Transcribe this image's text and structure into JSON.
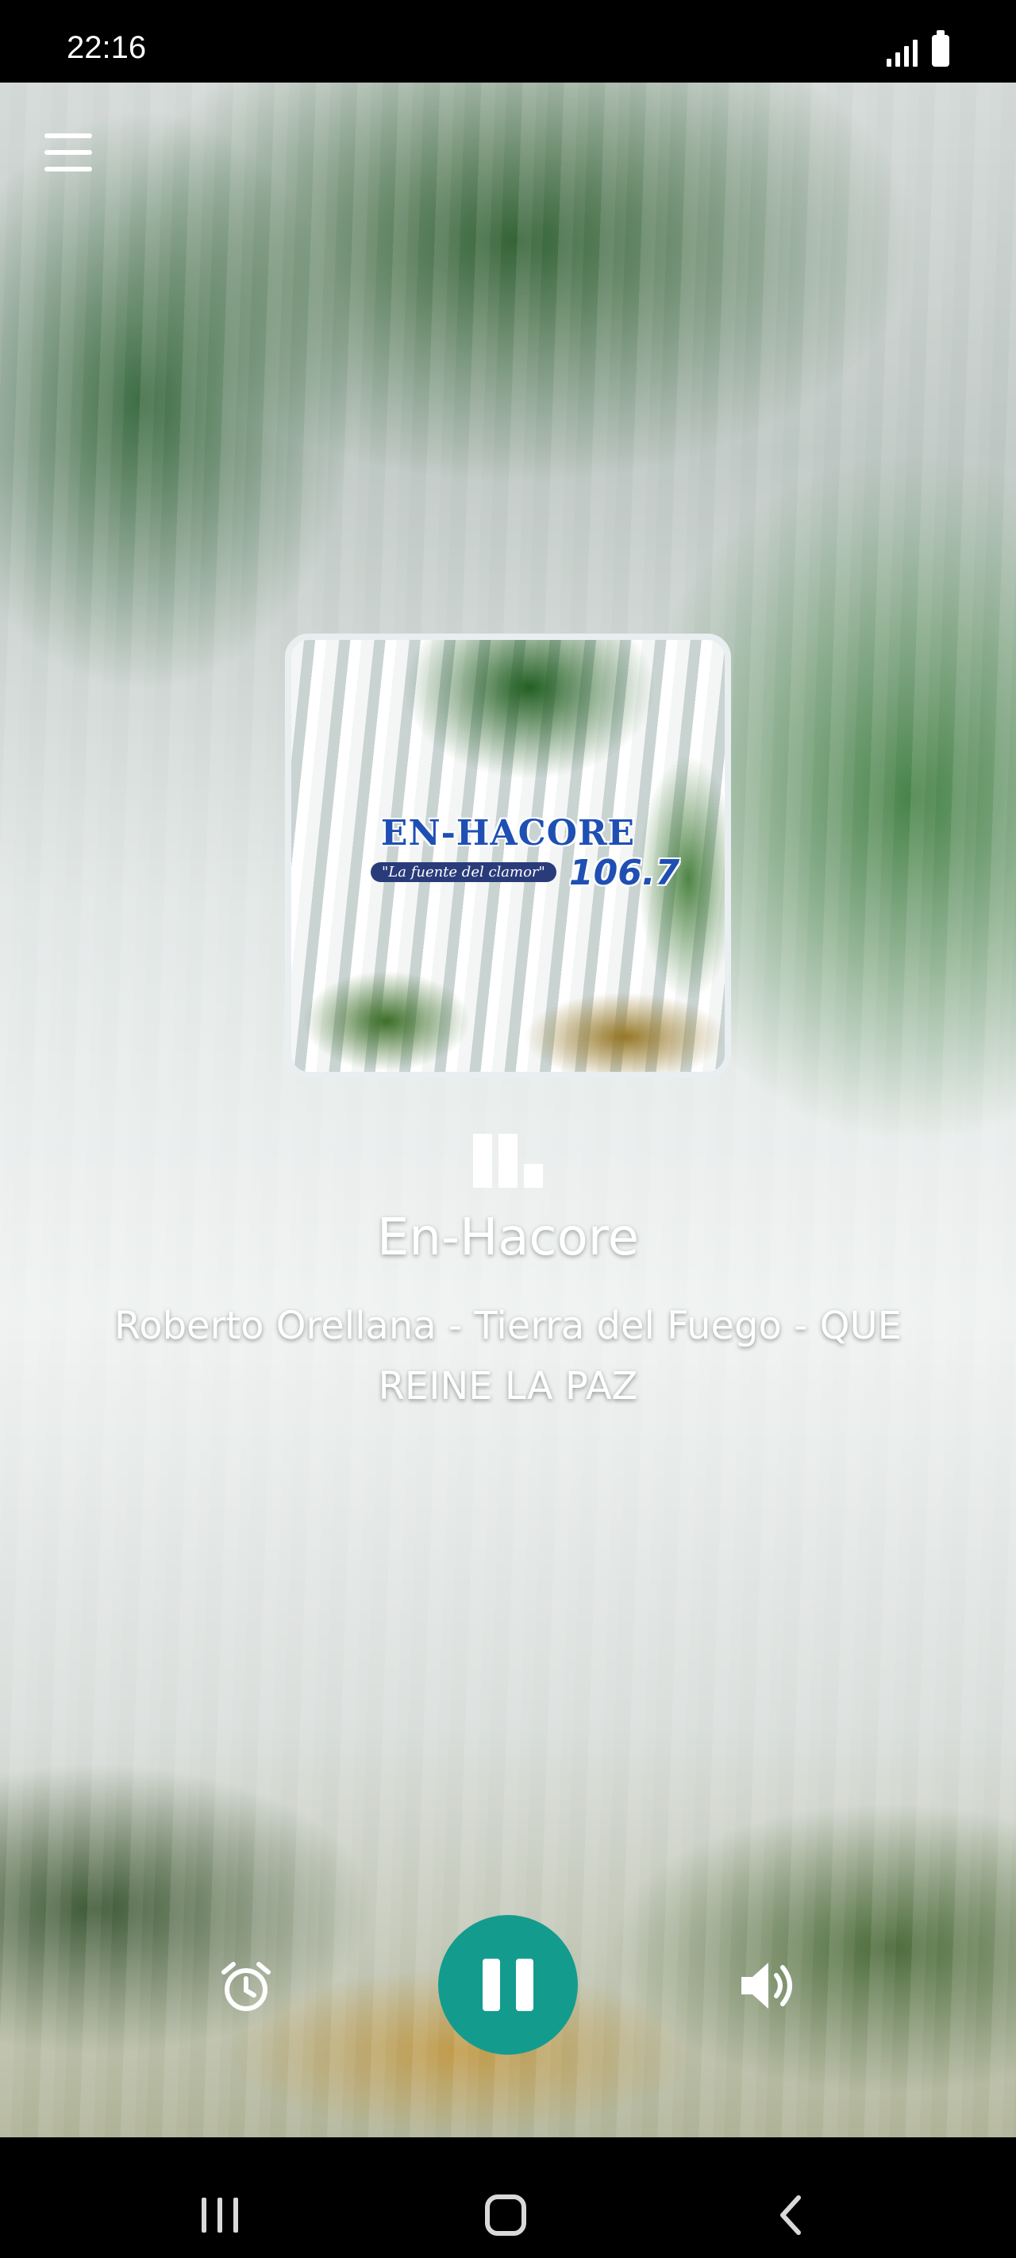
{
  "status_bar": {
    "time": "22:16",
    "icons": [
      "signal-icon",
      "battery-icon"
    ]
  },
  "header": {
    "menu_icon": "hamburger-menu-icon"
  },
  "artwork": {
    "logo_text": "EN-HACORE",
    "tagline": "\"La fuente del clamor\"",
    "frequency": "106.7"
  },
  "now_playing": {
    "station_name": "En-Hacore",
    "track_line1": "Roberto Orellana - Tierra del Fuego - QUE",
    "track_line2": "REINE LA PAZ",
    "visualizer_icon": "equalizer-bars-icon"
  },
  "controls": {
    "alarm_icon": "alarm-clock-icon",
    "play_state": "playing",
    "pause_icon": "pause-icon",
    "volume_icon": "volume-icon",
    "accent_color": "#139c8e"
  },
  "nav_bar": {
    "icons": [
      "recent-apps-icon",
      "home-icon",
      "back-icon"
    ]
  }
}
